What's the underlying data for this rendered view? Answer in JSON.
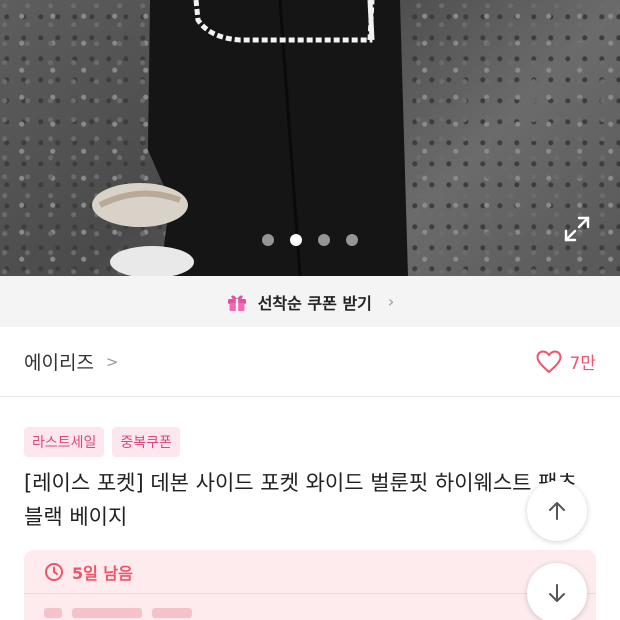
{
  "carousel": {
    "total": 4,
    "active_index": 1
  },
  "coupon": {
    "label": "선착순 쿠폰 받기",
    "icon": "gift-icon"
  },
  "brand": {
    "name": "에이리즈",
    "like_count": "7만"
  },
  "product": {
    "tags": [
      "라스트세일",
      "중복쿠폰"
    ],
    "title": "[레이스 포켓] 데본 사이드 포켓 와이드 벌룬핏 하이웨스트 팬츠 블랙 베이지"
  },
  "deadline": {
    "label": "5일 남음",
    "icon": "clock-icon"
  },
  "colors": {
    "accent": "#f0536c",
    "tag_text": "#e0457b",
    "tag_bg": "#fde7ef",
    "deal_bg": "#fdebed"
  }
}
